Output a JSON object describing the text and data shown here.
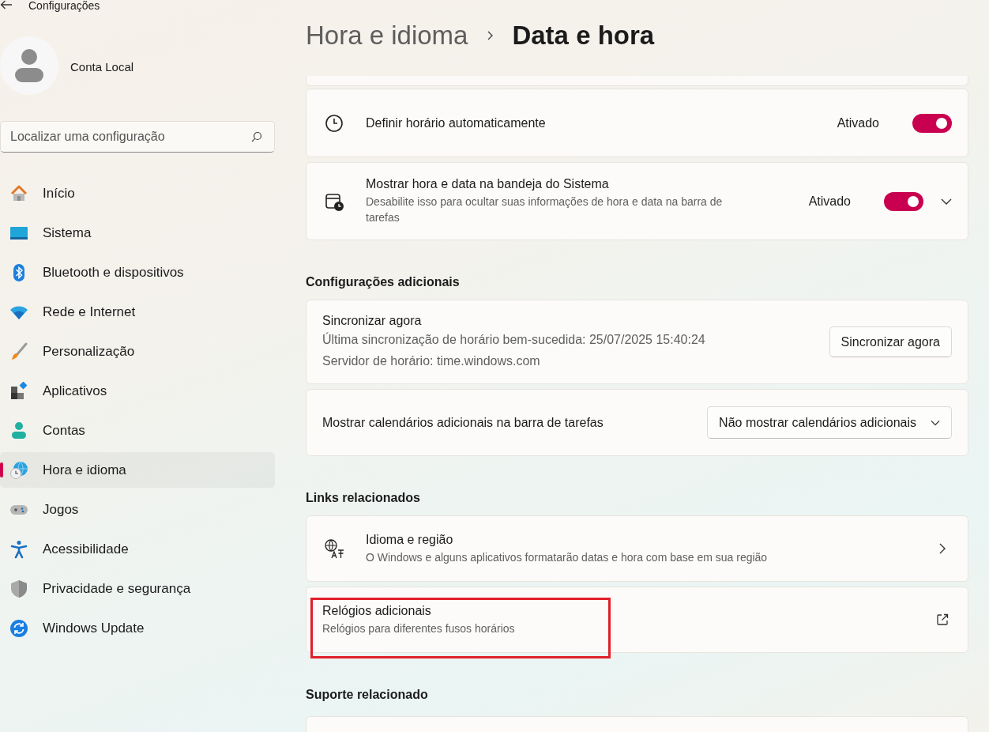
{
  "window": {
    "title": "Configurações"
  },
  "profile": {
    "name": "Conta Local"
  },
  "search": {
    "placeholder": "Localizar uma configuração"
  },
  "sidebar": {
    "items": [
      {
        "label": "Início",
        "selected": false
      },
      {
        "label": "Sistema",
        "selected": false
      },
      {
        "label": "Bluetooth e dispositivos",
        "selected": false
      },
      {
        "label": "Rede e Internet",
        "selected": false
      },
      {
        "label": "Personalização",
        "selected": false
      },
      {
        "label": "Aplicativos",
        "selected": false
      },
      {
        "label": "Contas",
        "selected": false
      },
      {
        "label": "Hora e idioma",
        "selected": true
      },
      {
        "label": "Jogos",
        "selected": false
      },
      {
        "label": "Acessibilidade",
        "selected": false
      },
      {
        "label": "Privacidade e segurança",
        "selected": false
      },
      {
        "label": "Windows Update",
        "selected": false
      }
    ]
  },
  "breadcrumb": {
    "parent": "Hora e idioma",
    "current": "Data e hora"
  },
  "sections": [
    {
      "cards": [
        {
          "kind": "toggle",
          "title": "Definir horário automaticamente",
          "state_label": "Ativado",
          "on": true
        },
        {
          "kind": "toggle",
          "title": "Mostrar hora e data na bandeja do Sistema",
          "description": "Desabilite isso para ocultar suas informações de hora e data na barra de tarefas",
          "state_label": "Ativado",
          "on": true,
          "expanded": false
        }
      ]
    },
    {
      "heading": "Configurações adicionais",
      "cards": [
        {
          "kind": "action",
          "title": "Sincronizar agora",
          "lines": [
            "Última sincronização de horário bem-sucedida: 25/07/2025 15:40:24",
            "Servidor de horário: time.windows.com"
          ],
          "button": "Sincronizar agora"
        },
        {
          "kind": "dropdown",
          "title": "Mostrar calendários adicionais na barra de tarefas",
          "value": "Não mostrar calendários adicionais"
        }
      ]
    },
    {
      "heading": "Links relacionados",
      "cards": [
        {
          "kind": "link",
          "title": "Idioma e região",
          "description": "O Windows e alguns aplicativos formatarão datas e hora com base em sua região",
          "external": false,
          "highlighted": false
        },
        {
          "kind": "link",
          "title": "Relógios adicionais",
          "description": "Relógios para diferentes fusos horários",
          "external": true,
          "highlighted": true
        }
      ]
    },
    {
      "heading": "Suporte relacionado"
    }
  ]
}
